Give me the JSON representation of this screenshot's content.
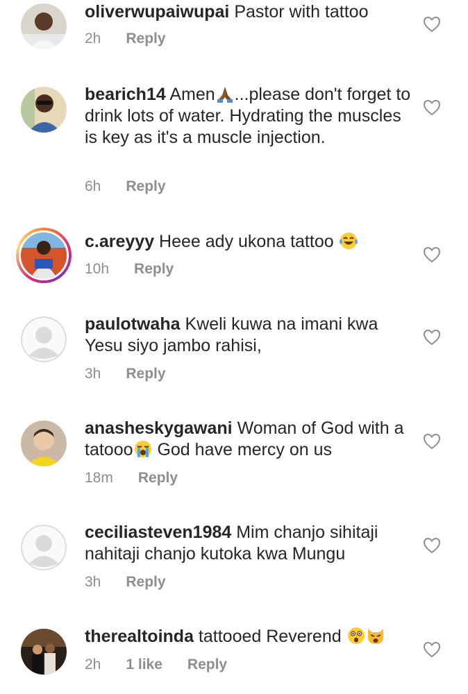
{
  "comments": [
    {
      "username": "oliverwupaiwupai",
      "text": " Pastor with tattoo",
      "time": "2h",
      "reply_label": "Reply"
    },
    {
      "username": "bearich14",
      "text_before": " Amen",
      "emoji": "praying-hands",
      "text_after": "...please don't forget to drink lots of water. Hydrating the muscles is key as it's  a muscle injection.",
      "time": "6h",
      "reply_label": "Reply"
    },
    {
      "username": "c.areyyy",
      "text": " Heee ady ukona tattoo ",
      "emoji": "tears-of-joy",
      "time": "10h",
      "reply_label": "Reply"
    },
    {
      "username": "paulotwaha",
      "text": " Kweli kuwa na imani kwa Yesu siyo jambo rahisi,",
      "time": "3h",
      "reply_label": "Reply"
    },
    {
      "username": "anasheskygawani",
      "text_before": " Woman of God with a tatooo",
      "emoji": "loudly-crying-face",
      "text_after": " God have mercy on us",
      "time": "18m",
      "reply_label": "Reply"
    },
    {
      "username": "ceciliasteven1984",
      "text": " Mim chanjo sihitaji nahitaji chanjo kutoka  kwa  Mungu",
      "time": "3h",
      "reply_label": "Reply"
    },
    {
      "username": "therealtoinda",
      "text": " tattooed Reverend ",
      "emojis": [
        "astonished-face",
        "weary-cat"
      ],
      "time": "2h",
      "likes": "1 like",
      "reply_label": "Reply"
    }
  ],
  "colors": {
    "text": "#262626",
    "secondary": "#8e8e8e",
    "story_ring": [
      "#f58529",
      "#dd2a7b",
      "#8134af"
    ]
  }
}
